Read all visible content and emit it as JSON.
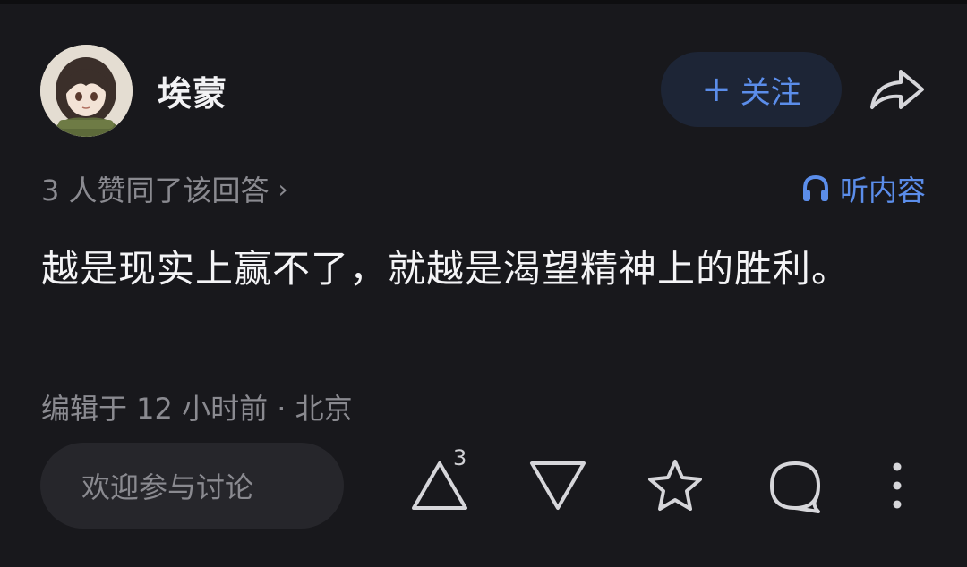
{
  "author": {
    "name": "埃蒙",
    "avatar_icon": "anime-avatar"
  },
  "follow": {
    "plus": "+",
    "label": "关注"
  },
  "meta": {
    "likes_text": "3 人赞同了该回答",
    "likes_chevron": "›",
    "listen_label": "听内容"
  },
  "answer": {
    "text": "越是现实上赢不了，就越是渴望精神上的胜利。",
    "edit_info": "编辑于 12 小时前 · 北京"
  },
  "bottom": {
    "comment_placeholder": "欢迎参与讨论",
    "upvote_count": "3"
  },
  "colors": {
    "background": "#18181c",
    "accent": "#5b8dea",
    "follow_bg": "#1d2536",
    "muted": "#8a8a90"
  }
}
